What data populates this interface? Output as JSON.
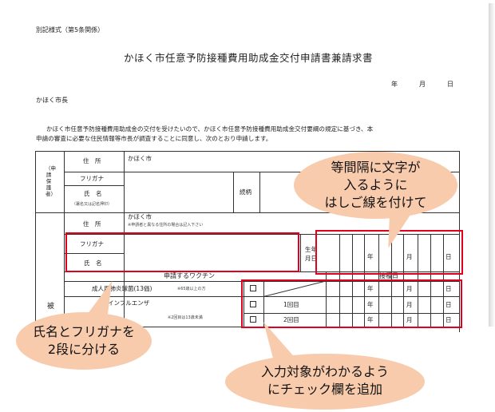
{
  "form": {
    "form_note": "別記様式（第5条関係）",
    "title": "かほく市任意予防接種費用助成金交付申請書兼請求書",
    "date": {
      "year": "年",
      "month": "月",
      "day": "日"
    },
    "addressee": "かほく市長",
    "intro_line1": "かほく市任意予防接種費用助成金の交付を受けたいので、かほく市任意予防接種費用助成金交付要綱の規定に基づき、本",
    "intro_line2": "申請の審査に必要な住民情報等市長が調査することに同意し、次のとおり申請します。"
  },
  "applicant": {
    "section": "（申請保護者）",
    "address_label": "住　所",
    "address_value": "かほく市",
    "furigana_label": "フリガナ",
    "name_label": "氏　名",
    "seal_note": "（署名又は記名押印）",
    "relation_label": "続柄"
  },
  "subject": {
    "section": "被",
    "address_label": "住　所",
    "address_value": "かほく市",
    "address_note": "※申請者と異なる住所の場合は記入下さい",
    "furigana_label": "フリガナ",
    "name_label": "氏　名",
    "birth_label_1": "生年",
    "birth_label_2": "月日",
    "birth_year": "年",
    "birth_month": "月",
    "birth_day": "日"
  },
  "vaccines": {
    "header_vaccine": "申請するワクチン",
    "header_date": "接種日",
    "row1_name": "成人用肺炎球菌(13価)",
    "row1_note": "※65歳以上の方",
    "row2_name": "インフルエンザ",
    "row2_dose1": "1回目",
    "row2_dose2": "2回目",
    "row2_note": "※2回目は13歳未満",
    "year": "年",
    "month": "月",
    "day": "日"
  },
  "callouts": {
    "top_right": "等間隔に文字が\n入るように\nはしご線を付けて",
    "bottom_left": "氏名とフリガナを\n2段に分ける",
    "bottom_right": "入力対象がわかるよう\nにチェック欄を追加"
  },
  "colors": {
    "highlight": "#e1001e",
    "bubble": "#f8cbad"
  }
}
